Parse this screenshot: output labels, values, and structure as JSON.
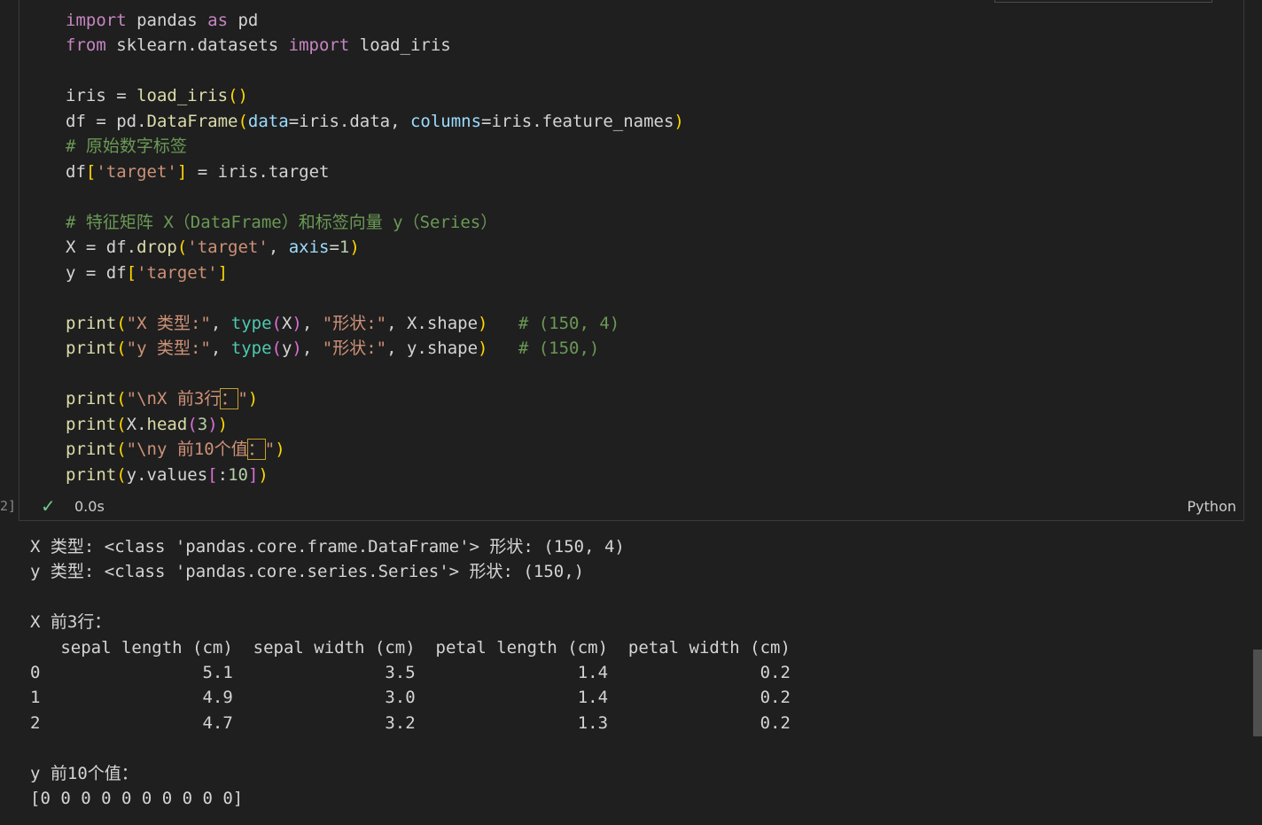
{
  "cell": {
    "execution_count": "2]",
    "status_time": "0.0s",
    "language": "Python",
    "check_icon": "check-icon"
  },
  "code": {
    "l1_kw1": "import",
    "l1_mod": " pandas ",
    "l1_kw2": "as",
    "l1_alias": " pd",
    "l2_kw1": "from",
    "l2_mod": " sklearn.datasets ",
    "l2_kw2": "import",
    "l2_name": " load_iris",
    "l4_a": "iris = ",
    "l4_fn": "load_iris",
    "l4_b": "()",
    "l5_a": "df = pd.",
    "l5_fn": "DataFrame",
    "l5_o": "(",
    "l5_p1": "data",
    "l5_b": "=iris.data, ",
    "l5_p2": "columns",
    "l5_c": "=iris.feature_names",
    "l5_cl": ")",
    "l6_comment": "# 原始数字标签",
    "l7_a": "df",
    "l7_o": "[",
    "l7_str": "'target'",
    "l7_cl": "]",
    "l7_b": " = iris.target",
    "l9_comment": "# 特征矩阵 X（DataFrame）和标签向量 y（Series）",
    "l10_a": "X = df.",
    "l10_fn": "drop",
    "l10_o": "(",
    "l10_str": "'target'",
    "l10_b": ", ",
    "l10_p": "axis",
    "l10_c": "=",
    "l10_num": "1",
    "l10_cl": ")",
    "l11_a": "y = df",
    "l11_o": "[",
    "l11_str": "'target'",
    "l11_cl": "]",
    "l13_fn": "print",
    "l13_o": "(",
    "l13_s1": "\"X 类型:\"",
    "l13_b": ", ",
    "l13_t": "type",
    "l13_o2": "(",
    "l13_x": "X",
    "l13_c2": ")",
    "l13_c": ", ",
    "l13_s2": "\"形状:\"",
    "l13_d": ", X.shape",
    "l13_cl": ")",
    "l13_cm": "   # (150, 4)",
    "l14_fn": "print",
    "l14_o": "(",
    "l14_s1": "\"y 类型:\"",
    "l14_b": ", ",
    "l14_t": "type",
    "l14_o2": "(",
    "l14_x": "y",
    "l14_c2": ")",
    "l14_c": ", ",
    "l14_s2": "\"形状:\"",
    "l14_d": ", y.shape",
    "l14_cl": ")",
    "l14_cm": "   # (150,)",
    "l16_fn": "print",
    "l16_o": "(",
    "l16_s": "\"\\nX 前3行",
    "l16_hl": "：",
    "l16_e": "\"",
    "l16_cl": ")",
    "l17_fn": "print",
    "l17_o": "(",
    "l17_a": "X.",
    "l17_fn2": "head",
    "l17_o2": "(",
    "l17_num": "3",
    "l17_c2": ")",
    "l17_cl": ")",
    "l18_fn": "print",
    "l18_o": "(",
    "l18_s": "\"\\ny 前10个值",
    "l18_hl": "：",
    "l18_e": "\"",
    "l18_cl": ")",
    "l19_fn": "print",
    "l19_o": "(",
    "l19_a": "y.values",
    "l19_o2": "[",
    "l19_b": ":",
    "l19_num": "10",
    "l19_c2": "]",
    "l19_cl": ")"
  },
  "output": {
    "lines": [
      "X 类型: <class 'pandas.core.frame.DataFrame'> 形状: (150, 4)",
      "y 类型: <class 'pandas.core.series.Series'> 形状: (150,)",
      "",
      "X 前3行：",
      "   sepal length (cm)  sepal width (cm)  petal length (cm)  petal width (cm)",
      "0                5.1               3.5                1.4               0.2",
      "1                4.9               3.0                1.4               0.2",
      "2                4.7               3.2                1.3               0.2",
      "",
      "y 前10个值：",
      "[0 0 0 0 0 0 0 0 0 0]"
    ]
  }
}
